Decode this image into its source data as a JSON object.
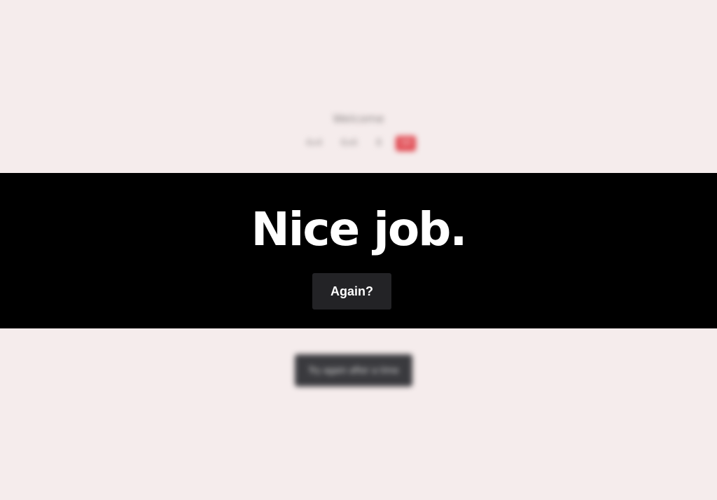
{
  "background": {
    "title": "Welcome",
    "options": [
      {
        "label": "4x4",
        "active": false
      },
      {
        "label": "6x6",
        "active": false
      },
      {
        "label": "8",
        "active": false
      },
      {
        "label": "10",
        "active": true
      }
    ],
    "button_label": "Try again after a time"
  },
  "overlay": {
    "headline": "Nice job.",
    "again_label": "Again?"
  },
  "colors": {
    "page_bg": "#f5ecec",
    "overlay_bg": "#000000",
    "accent": "#e0474f",
    "button_bg": "#232326"
  }
}
